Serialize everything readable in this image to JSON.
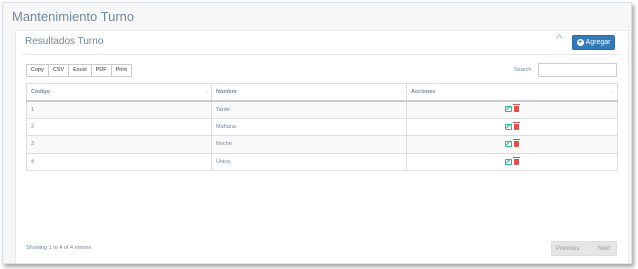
{
  "page": {
    "title": "Mantenimiento Turno"
  },
  "panel": {
    "title": "Resultados Turno",
    "add_button_label": "Agregar",
    "collapse_icon": "chevron-up-icon"
  },
  "export_buttons": [
    "Copy",
    "CSV",
    "Excel",
    "PDF",
    "Print"
  ],
  "search": {
    "label": "Search",
    "value": ""
  },
  "table": {
    "headers": [
      "Código",
      "Nombre",
      "Acciones"
    ],
    "rows": [
      {
        "codigo": "1",
        "nombre": "Tarde"
      },
      {
        "codigo": "2",
        "nombre": "Mañana"
      },
      {
        "codigo": "3",
        "nombre": "Noche"
      },
      {
        "codigo": "4",
        "nombre": "Único"
      }
    ]
  },
  "footer": {
    "info": "Showing 1 to 4 of 4 entries",
    "prev_label": "Previous",
    "next_label": "Next"
  },
  "colors": {
    "primary": "#337ab7",
    "edit": "#26b99a",
    "delete": "#d9534f"
  }
}
